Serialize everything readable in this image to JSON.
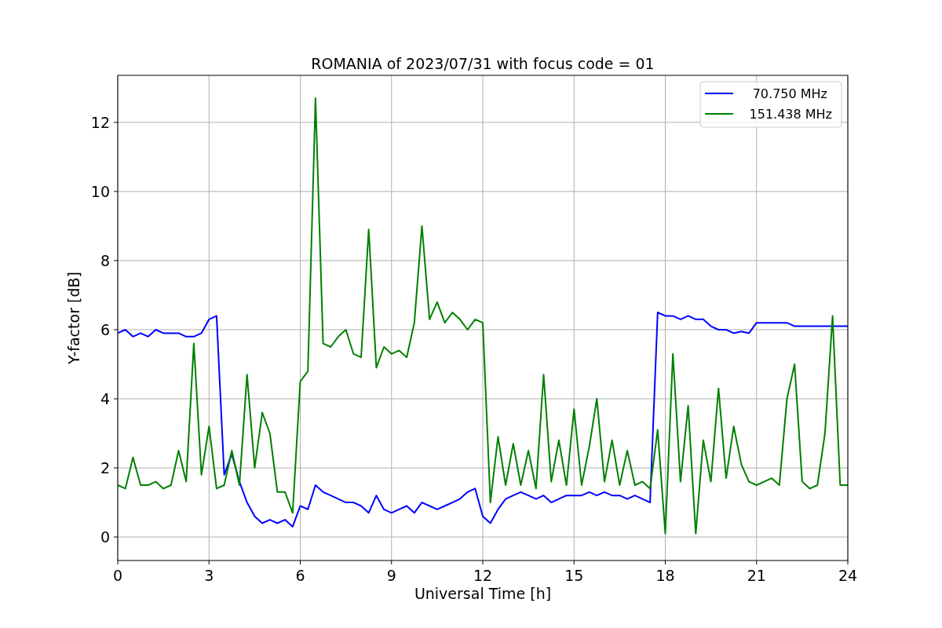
{
  "chart": {
    "chart_data": {
      "type": "line",
      "title": "ROMANIA of 2023/07/31 with focus code = 01",
      "xlabel": "Universal Time [h]",
      "ylabel": "Y-factor [dB]",
      "x": [
        0,
        0.25,
        0.5,
        0.75,
        1,
        1.25,
        1.5,
        1.75,
        2,
        2.25,
        2.5,
        2.75,
        3,
        3.25,
        3.5,
        3.75,
        4,
        4.25,
        4.5,
        4.75,
        5,
        5.25,
        5.5,
        5.75,
        6,
        6.25,
        6.5,
        6.75,
        7,
        7.25,
        7.5,
        7.75,
        8,
        8.25,
        8.5,
        8.75,
        9,
        9.25,
        9.5,
        9.75,
        10,
        10.25,
        10.5,
        10.75,
        11,
        11.25,
        11.5,
        11.75,
        12,
        12.25,
        12.5,
        12.75,
        13,
        13.25,
        13.5,
        13.75,
        14,
        14.25,
        14.5,
        14.75,
        15,
        15.25,
        15.5,
        15.75,
        16,
        16.25,
        16.5,
        16.75,
        17,
        17.25,
        17.5,
        17.75,
        18,
        18.25,
        18.5,
        18.75,
        19,
        19.25,
        19.5,
        19.75,
        20,
        20.25,
        20.5,
        20.75,
        21,
        21.25,
        21.5,
        21.75,
        22,
        22.25,
        22.5,
        22.75,
        23,
        23.25,
        23.5,
        23.75,
        24
      ],
      "series": [
        {
          "name": "70.750 MHz",
          "color": "#0000ff",
          "values": [
            5.9,
            6.0,
            5.8,
            5.9,
            5.8,
            6.0,
            5.9,
            5.9,
            5.9,
            5.8,
            5.8,
            5.9,
            6.3,
            6.4,
            1.8,
            2.4,
            1.6,
            1.0,
            0.6,
            0.4,
            0.5,
            0.4,
            0.5,
            0.3,
            0.9,
            0.8,
            1.5,
            1.3,
            1.2,
            1.1,
            1.0,
            1.0,
            0.9,
            0.7,
            1.2,
            0.8,
            0.7,
            0.8,
            0.9,
            0.7,
            1.0,
            0.9,
            0.8,
            0.9,
            1.0,
            1.1,
            1.3,
            1.4,
            0.6,
            0.4,
            0.8,
            1.1,
            1.2,
            1.3,
            1.2,
            1.1,
            1.2,
            1.0,
            1.1,
            1.2,
            1.2,
            1.2,
            1.3,
            1.2,
            1.3,
            1.2,
            1.2,
            1.1,
            1.2,
            1.1,
            1.0,
            6.5,
            6.4,
            6.4,
            6.3,
            6.4,
            6.3,
            6.3,
            6.1,
            6.0,
            6.0,
            5.9,
            5.95,
            5.9,
            6.2,
            6.2,
            6.2,
            6.2,
            6.2,
            6.1,
            6.1,
            6.1,
            6.1,
            6.1,
            6.1,
            6.1,
            6.1
          ]
        },
        {
          "name": "151.438 MHz",
          "color": "#008000",
          "values": [
            1.5,
            1.4,
            2.3,
            1.5,
            1.5,
            1.6,
            1.4,
            1.5,
            2.5,
            1.6,
            5.6,
            1.8,
            3.2,
            1.4,
            1.5,
            2.5,
            1.5,
            4.7,
            2.0,
            3.6,
            3.0,
            1.3,
            1.3,
            0.7,
            4.5,
            4.8,
            12.7,
            5.6,
            5.5,
            5.8,
            6.0,
            5.3,
            5.2,
            8.9,
            4.9,
            5.5,
            5.3,
            5.4,
            5.2,
            6.2,
            9.0,
            6.3,
            6.8,
            6.2,
            6.5,
            6.3,
            6.0,
            6.3,
            6.2,
            1.0,
            2.9,
            1.5,
            2.7,
            1.5,
            2.5,
            1.4,
            4.7,
            1.6,
            2.8,
            1.5,
            3.7,
            1.5,
            2.6,
            4.0,
            1.6,
            2.8,
            1.5,
            2.5,
            1.5,
            1.6,
            1.4,
            3.1,
            0.1,
            5.3,
            1.6,
            3.8,
            0.1,
            2.8,
            1.6,
            4.3,
            1.7,
            3.2,
            2.1,
            1.6,
            1.5,
            1.6,
            1.7,
            1.5,
            4.0,
            5.0,
            1.6,
            1.4,
            1.5,
            3.0,
            6.4,
            1.5,
            1.5
          ]
        }
      ],
      "xlim": [
        0,
        24
      ],
      "ylim": [
        -0.68,
        13.36
      ],
      "xticks": [
        0,
        3,
        6,
        9,
        12,
        15,
        18,
        21,
        24
      ],
      "yticks": [
        0,
        2,
        4,
        6,
        8,
        10,
        12
      ],
      "grid": true,
      "legend": true
    }
  }
}
